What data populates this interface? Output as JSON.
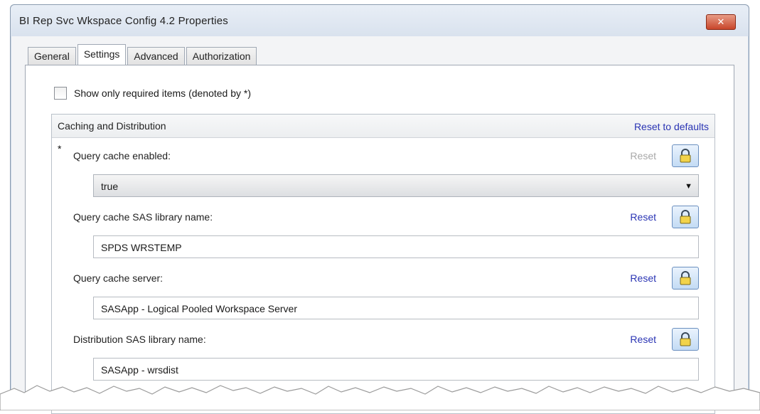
{
  "window": {
    "title": "BI Rep Svc Wkspace Config 4.2 Properties",
    "close_label": "✕"
  },
  "tabs": [
    {
      "label": "General",
      "active": false
    },
    {
      "label": "Settings",
      "active": true
    },
    {
      "label": "Advanced",
      "active": false
    },
    {
      "label": "Authorization",
      "active": false
    }
  ],
  "settings": {
    "required_only_label": "Show only required items (denoted by *)",
    "required_only_checked": false,
    "group": {
      "title": "Caching and Distribution",
      "reset_defaults_label": "Reset to defaults",
      "fields": [
        {
          "required_mark": "*",
          "label": "Query cache enabled:",
          "reset_label": "Reset",
          "reset_enabled": false,
          "type": "select",
          "value": "true"
        },
        {
          "label": "Query cache SAS library name:",
          "reset_label": "Reset",
          "reset_enabled": true,
          "type": "text",
          "value": "SPDS WRSTEMP"
        },
        {
          "label": "Query cache server:",
          "reset_label": "Reset",
          "reset_enabled": true,
          "type": "text",
          "value": "SASApp - Logical Pooled Workspace Server"
        },
        {
          "label": "Distribution SAS library name:",
          "reset_label": "Reset",
          "reset_enabled": true,
          "type": "text",
          "value": "SASApp - wrsdist"
        }
      ]
    }
  },
  "icons": {
    "close": "close-icon",
    "lock": "lock-icon",
    "dropdown": "chevron-down-icon",
    "checkbox": "checkbox-icon"
  },
  "colors": {
    "link": "#2a34b4",
    "disabled": "#a8a8a8",
    "close_button": "#c8462b"
  }
}
